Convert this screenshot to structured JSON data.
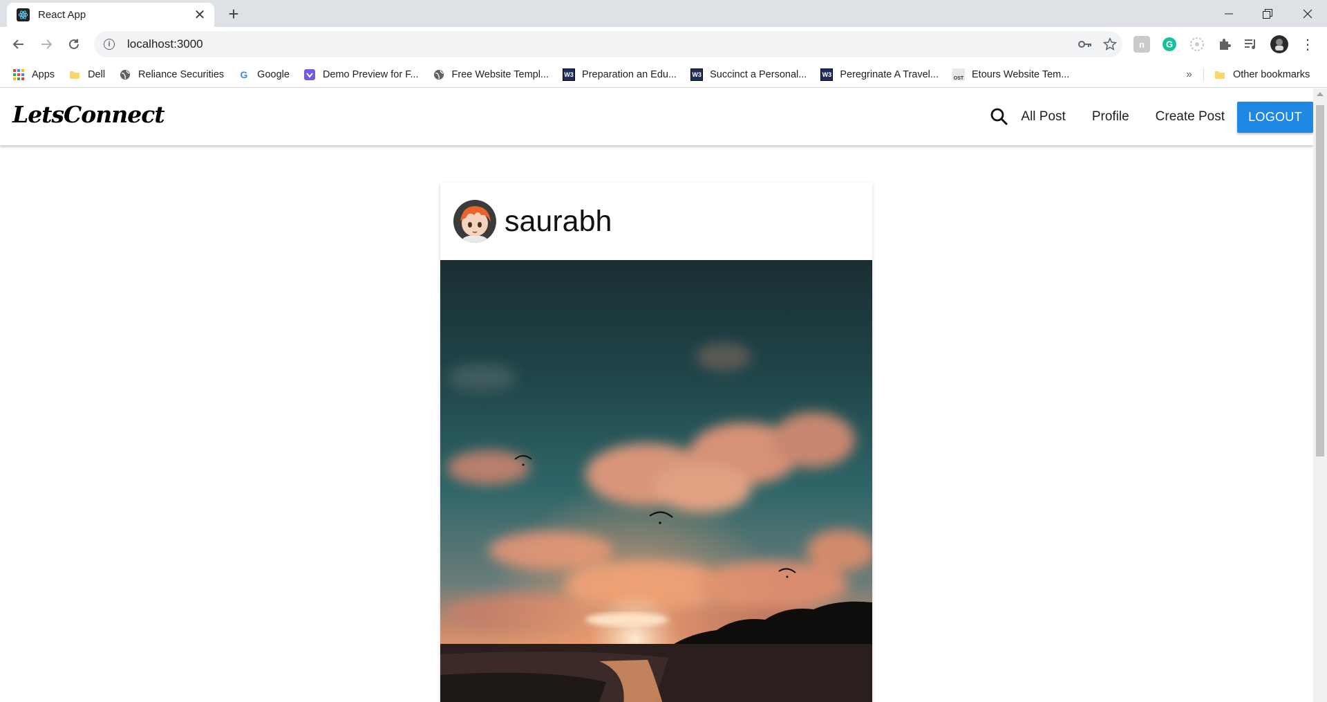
{
  "browser": {
    "tab_title": "React App",
    "url": "localhost:3000",
    "bookmarks": [
      {
        "label": "Apps",
        "icon": "apps-grid-icon"
      },
      {
        "label": "Dell",
        "icon": "folder-icon"
      },
      {
        "label": "Reliance Securities",
        "icon": "globe-icon"
      },
      {
        "label": "Google",
        "icon": "google-icon"
      },
      {
        "label": "Demo Preview for F...",
        "icon": "demo-icon"
      },
      {
        "label": "Free Website Templ...",
        "icon": "globe-icon"
      },
      {
        "label": "Preparation an Edu...",
        "icon": "w3-icon"
      },
      {
        "label": "Succinct a Personal...",
        "icon": "w3-icon"
      },
      {
        "label": "Peregrinate A Travel...",
        "icon": "w3-icon"
      },
      {
        "label": "Etours Website Tem...",
        "icon": "ost-icon"
      }
    ],
    "more_bookmarks": "»",
    "other_bookmarks": "Other bookmarks"
  },
  "app": {
    "brand": "LetsConnect",
    "nav": {
      "all_post": "All Post",
      "profile": "Profile",
      "create_post": "Create Post",
      "logout": "LOGOUT"
    },
    "accent_color": "#1e88e5"
  },
  "post": {
    "username": "saurabh"
  }
}
